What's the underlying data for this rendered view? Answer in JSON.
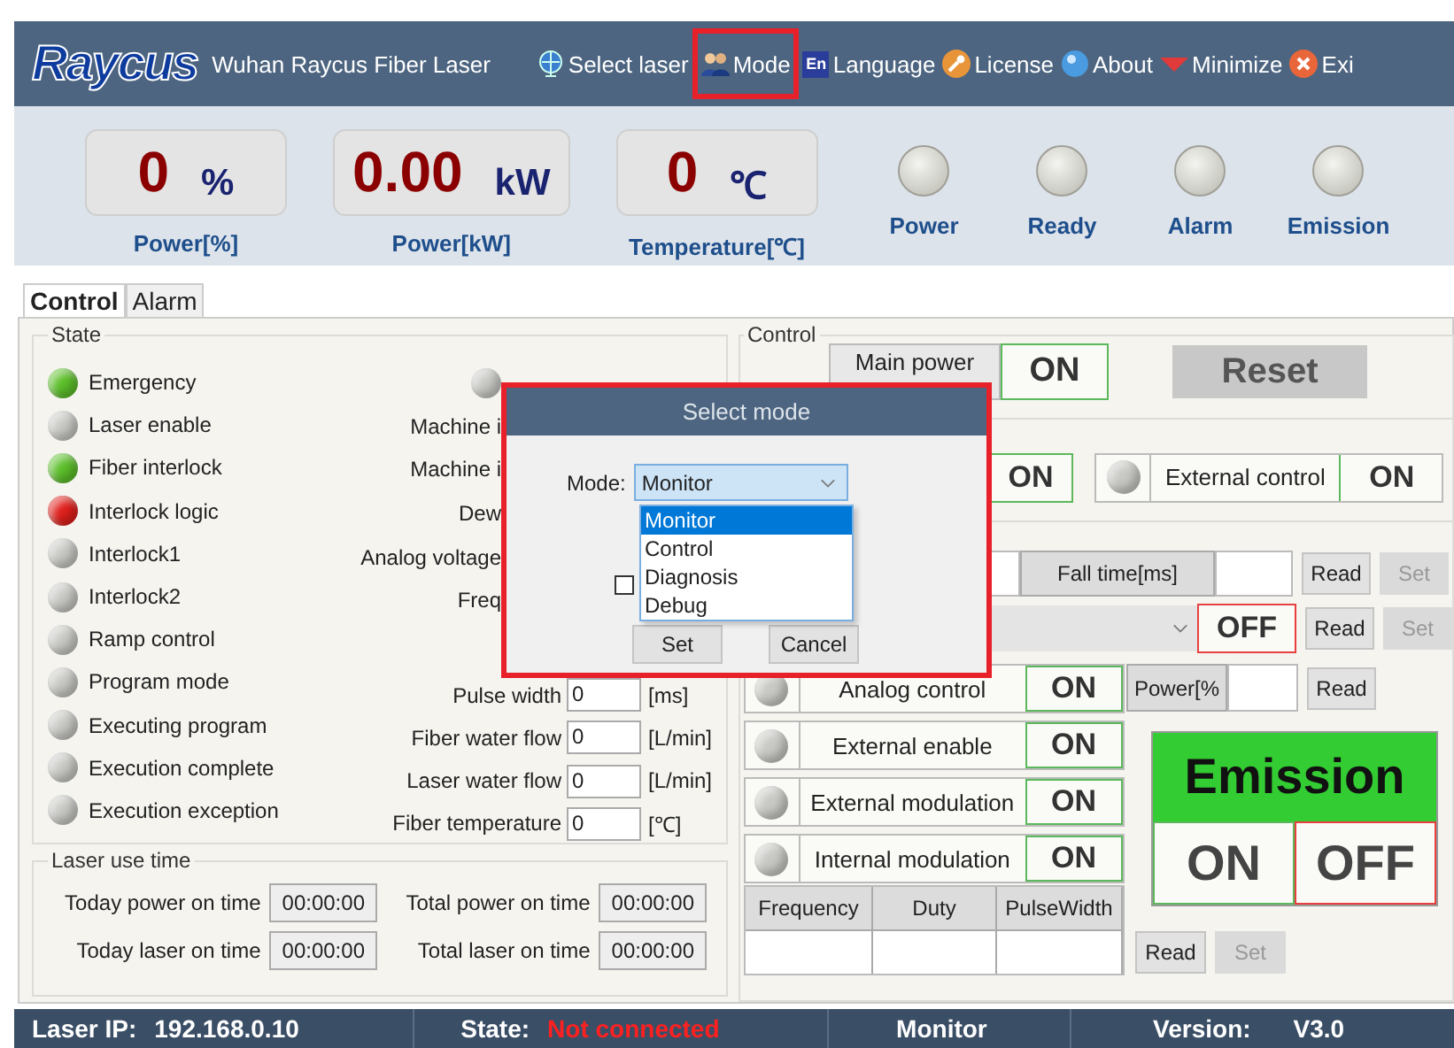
{
  "header": {
    "logo": "Raycus",
    "title": "Wuhan Raycus Fiber Laser",
    "menu": [
      {
        "label": "Select laser",
        "highlighted": false
      },
      {
        "label": "Mode",
        "highlighted": true
      },
      {
        "label": "Language",
        "icon_text": "En",
        "highlighted": false
      },
      {
        "label": "License",
        "highlighted": false
      },
      {
        "label": "About",
        "highlighted": false
      },
      {
        "label": "Minimize",
        "highlighted": false
      },
      {
        "label": "Exi",
        "highlighted": false
      }
    ]
  },
  "readouts": [
    {
      "value": "0",
      "unit": "%",
      "label": "Power[%]"
    },
    {
      "value": "0.00",
      "unit": "kW",
      "label": "Power[kW]"
    },
    {
      "value": "0",
      "unit": "℃",
      "label": "Temperature[℃]"
    }
  ],
  "indicators": [
    {
      "label": "Power",
      "on": false
    },
    {
      "label": "Ready",
      "on": false
    },
    {
      "label": "Alarm",
      "on": false
    },
    {
      "label": "Emission",
      "on": false
    }
  ],
  "tabs": [
    {
      "label": "Control",
      "selected": true
    },
    {
      "label": "Alarm",
      "selected": false
    }
  ],
  "state": {
    "title": "State",
    "lamps": [
      {
        "label": "Emergency",
        "color": "#5cbf2a"
      },
      {
        "label": "Laser enable",
        "color": "#c8c8c4"
      },
      {
        "label": "Fiber interlock",
        "color": "#5cbf2a"
      },
      {
        "label": "Interlock logic",
        "color": "#e0201c"
      },
      {
        "label": "Interlock1",
        "color": "#c8c8c4"
      },
      {
        "label": "Interlock2",
        "color": "#c8c8c4"
      },
      {
        "label": "Ramp control",
        "color": "#c8c8c4"
      },
      {
        "label": "Program mode",
        "color": "#c8c8c4"
      },
      {
        "label": "Executing program",
        "color": "#c8c8c4"
      },
      {
        "label": "Execution complete",
        "color": "#c8c8c4"
      },
      {
        "label": "Execution exception",
        "color": "#c8c8c4"
      }
    ],
    "covered_rows": [
      {
        "kind": "lamp",
        "color": "#c8c8c4"
      },
      {
        "kind": "label",
        "label": "Machine i"
      },
      {
        "kind": "label",
        "label": "Machine i"
      },
      {
        "kind": "label",
        "label": "Dew"
      },
      {
        "kind": "label",
        "label": "Analog voltage"
      },
      {
        "kind": "label",
        "label": "Freq"
      }
    ],
    "fields": [
      {
        "label": "Pulse width",
        "value": "0",
        "unit": "[ms]"
      },
      {
        "label": "Fiber water flow",
        "value": "0",
        "unit": "[L/min]"
      },
      {
        "label": "Laser water flow",
        "value": "0",
        "unit": "[L/min]"
      },
      {
        "label": "Fiber temperature",
        "value": "0",
        "unit": "[℃]"
      }
    ]
  },
  "use_time": {
    "title": "Laser use time",
    "items": [
      {
        "label": "Today power on time",
        "value": "00:00:00"
      },
      {
        "label": "Total power on time",
        "value": "00:00:00"
      },
      {
        "label": "Today laser on time",
        "value": "00:00:00"
      },
      {
        "label": "Total laser on time",
        "value": "00:00:00"
      }
    ]
  },
  "control": {
    "title": "Control",
    "main_power": {
      "label": "Main power",
      "switch": {
        "text": "ON",
        "on": true
      }
    },
    "reset": "Reset",
    "covered_switch": {
      "text": "ON",
      "on": true
    },
    "external_control": {
      "label": "External control",
      "color": "#c8c8c4",
      "switch": {
        "text": "ON",
        "on": true
      }
    },
    "fall_time": {
      "label": "Fall time[ms]",
      "read": "Read",
      "set": "Set",
      "set_disabled": true
    },
    "select_row": {
      "switch": {
        "text": "OFF",
        "on": false
      },
      "read": "Read",
      "set": "Set",
      "set_disabled": true
    },
    "modulation": [
      {
        "label": "Analog control",
        "color": "#c8c8c4",
        "switch": {
          "text": "ON",
          "on": true
        }
      },
      {
        "label": "External enable",
        "color": "#c8c8c4",
        "switch": {
          "text": "ON",
          "on": true
        }
      },
      {
        "label": "External modulation",
        "color": "#c8c8c4",
        "switch": {
          "text": "ON",
          "on": true
        }
      },
      {
        "label": "Internal modulation",
        "color": "#c8c8c4",
        "switch": {
          "text": "ON",
          "on": true
        }
      }
    ],
    "power": {
      "label": "Power[%",
      "read": "Read"
    },
    "pulse_table": {
      "columns": [
        "Frequency",
        "Duty",
        "PulseWidth"
      ]
    },
    "emission": {
      "title": "Emission",
      "on_label": "ON",
      "off_label": "OFF",
      "read": "Read",
      "set": "Set",
      "set_disabled": true
    }
  },
  "dialog": {
    "title": "Select mode",
    "mode_label": "Mode:",
    "value": "Monitor",
    "options": [
      {
        "label": "Monitor",
        "selected": true
      },
      {
        "label": "Control",
        "selected": false
      },
      {
        "label": "Diagnosis",
        "selected": false
      },
      {
        "label": "Debug",
        "selected": false
      }
    ],
    "checked": false,
    "buttons": [
      "Set",
      "Cancel"
    ]
  },
  "status_bar": {
    "ip_label": "Laser IP:",
    "ip": "192.168.0.10",
    "state_label": "State:",
    "state": "Not connected",
    "mode": "Monitor",
    "version_label": "Version:",
    "version": "V3.0"
  }
}
